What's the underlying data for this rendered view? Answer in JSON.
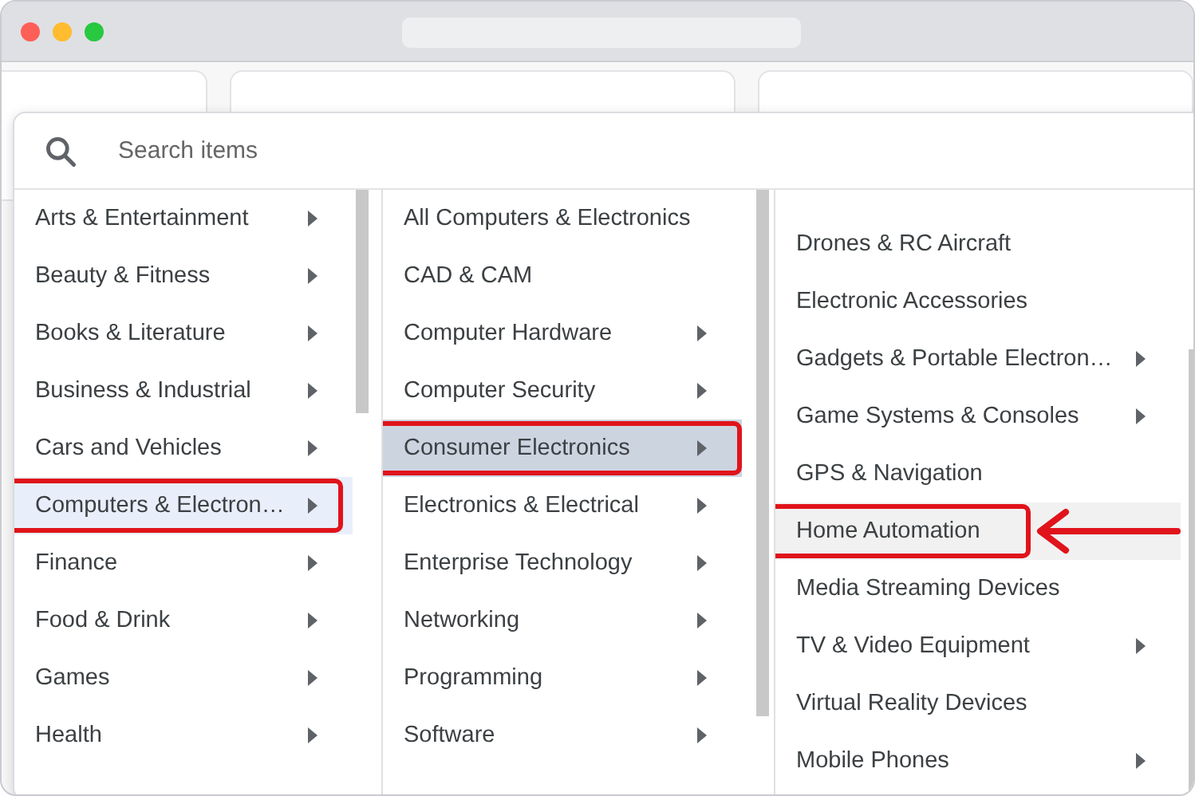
{
  "search": {
    "placeholder": "Search items"
  },
  "columns": [
    {
      "items": [
        {
          "label": "Arts & Entertainment",
          "has_submenu": true,
          "selected": false,
          "annotated": false
        },
        {
          "label": "Beauty & Fitness",
          "has_submenu": true,
          "selected": false,
          "annotated": false
        },
        {
          "label": "Books & Literature",
          "has_submenu": true,
          "selected": false,
          "annotated": false
        },
        {
          "label": "Business & Industrial",
          "has_submenu": true,
          "selected": false,
          "annotated": false
        },
        {
          "label": "Cars and Vehicles",
          "has_submenu": true,
          "selected": false,
          "annotated": false
        },
        {
          "label": "Computers & Electron…",
          "has_submenu": true,
          "selected": true,
          "annotated": true
        },
        {
          "label": "Finance",
          "has_submenu": true,
          "selected": false,
          "annotated": false
        },
        {
          "label": "Food & Drink",
          "has_submenu": true,
          "selected": false,
          "annotated": false
        },
        {
          "label": "Games",
          "has_submenu": true,
          "selected": false,
          "annotated": false
        },
        {
          "label": "Health",
          "has_submenu": true,
          "selected": false,
          "annotated": false
        }
      ]
    },
    {
      "items": [
        {
          "label": "All Computers & Electronics",
          "has_submenu": false,
          "selected": false,
          "annotated": false
        },
        {
          "label": "CAD & CAM",
          "has_submenu": false,
          "selected": false,
          "annotated": false
        },
        {
          "label": "Computer Hardware",
          "has_submenu": true,
          "selected": false,
          "annotated": false
        },
        {
          "label": "Computer Security",
          "has_submenu": true,
          "selected": false,
          "annotated": false
        },
        {
          "label": "Consumer Electronics",
          "has_submenu": true,
          "selected": true,
          "annotated": true
        },
        {
          "label": "Electronics & Electrical",
          "has_submenu": true,
          "selected": false,
          "annotated": false
        },
        {
          "label": "Enterprise Technology",
          "has_submenu": true,
          "selected": false,
          "annotated": false
        },
        {
          "label": "Networking",
          "has_submenu": true,
          "selected": false,
          "annotated": false
        },
        {
          "label": "Programming",
          "has_submenu": true,
          "selected": false,
          "annotated": false
        },
        {
          "label": "Software",
          "has_submenu": true,
          "selected": false,
          "annotated": false
        }
      ]
    },
    {
      "items": [
        {
          "label": "Drones & RC Aircraft",
          "has_submenu": false,
          "selected": false,
          "annotated": false
        },
        {
          "label": "Electronic Accessories",
          "has_submenu": false,
          "selected": false,
          "annotated": false
        },
        {
          "label": "Gadgets & Portable Electron…",
          "has_submenu": true,
          "selected": false,
          "annotated": false
        },
        {
          "label": "Game Systems & Consoles",
          "has_submenu": true,
          "selected": false,
          "annotated": false
        },
        {
          "label": "GPS & Navigation",
          "has_submenu": false,
          "selected": false,
          "annotated": false
        },
        {
          "label": "Home Automation",
          "has_submenu": false,
          "selected": true,
          "annotated": true
        },
        {
          "label": "Media Streaming Devices",
          "has_submenu": false,
          "selected": false,
          "annotated": false
        },
        {
          "label": "TV & Video Equipment",
          "has_submenu": true,
          "selected": false,
          "annotated": false
        },
        {
          "label": "Virtual Reality Devices",
          "has_submenu": false,
          "selected": false,
          "annotated": false
        },
        {
          "label": "Mobile Phones",
          "has_submenu": true,
          "selected": false,
          "annotated": false
        }
      ]
    }
  ]
}
